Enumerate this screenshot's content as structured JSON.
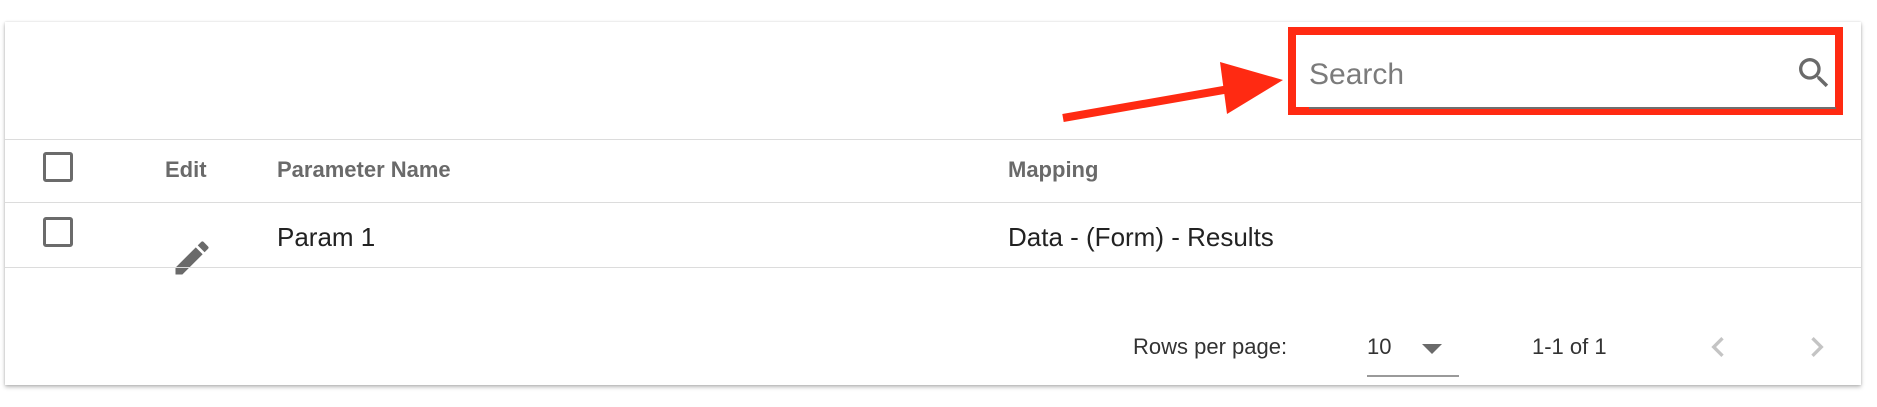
{
  "search": {
    "placeholder": "Search",
    "icon": "search-icon",
    "highlight_color": "#ff2a12"
  },
  "table": {
    "columns": [
      "",
      "Edit",
      "Parameter Name",
      "Mapping"
    ],
    "rows": [
      {
        "selected": false,
        "edit_icon": "pencil-icon",
        "parameter_name": "Param 1",
        "mapping": "Data - (Form) - Results"
      }
    ]
  },
  "pagination": {
    "rows_per_page_label": "Rows per page:",
    "rows_per_page_value": "10",
    "range_label": "1-1 of 1",
    "prev_icon": "chevron-left-icon",
    "next_icon": "chevron-right-icon"
  },
  "annotation": {
    "arrow_color": "#ff2a12"
  }
}
